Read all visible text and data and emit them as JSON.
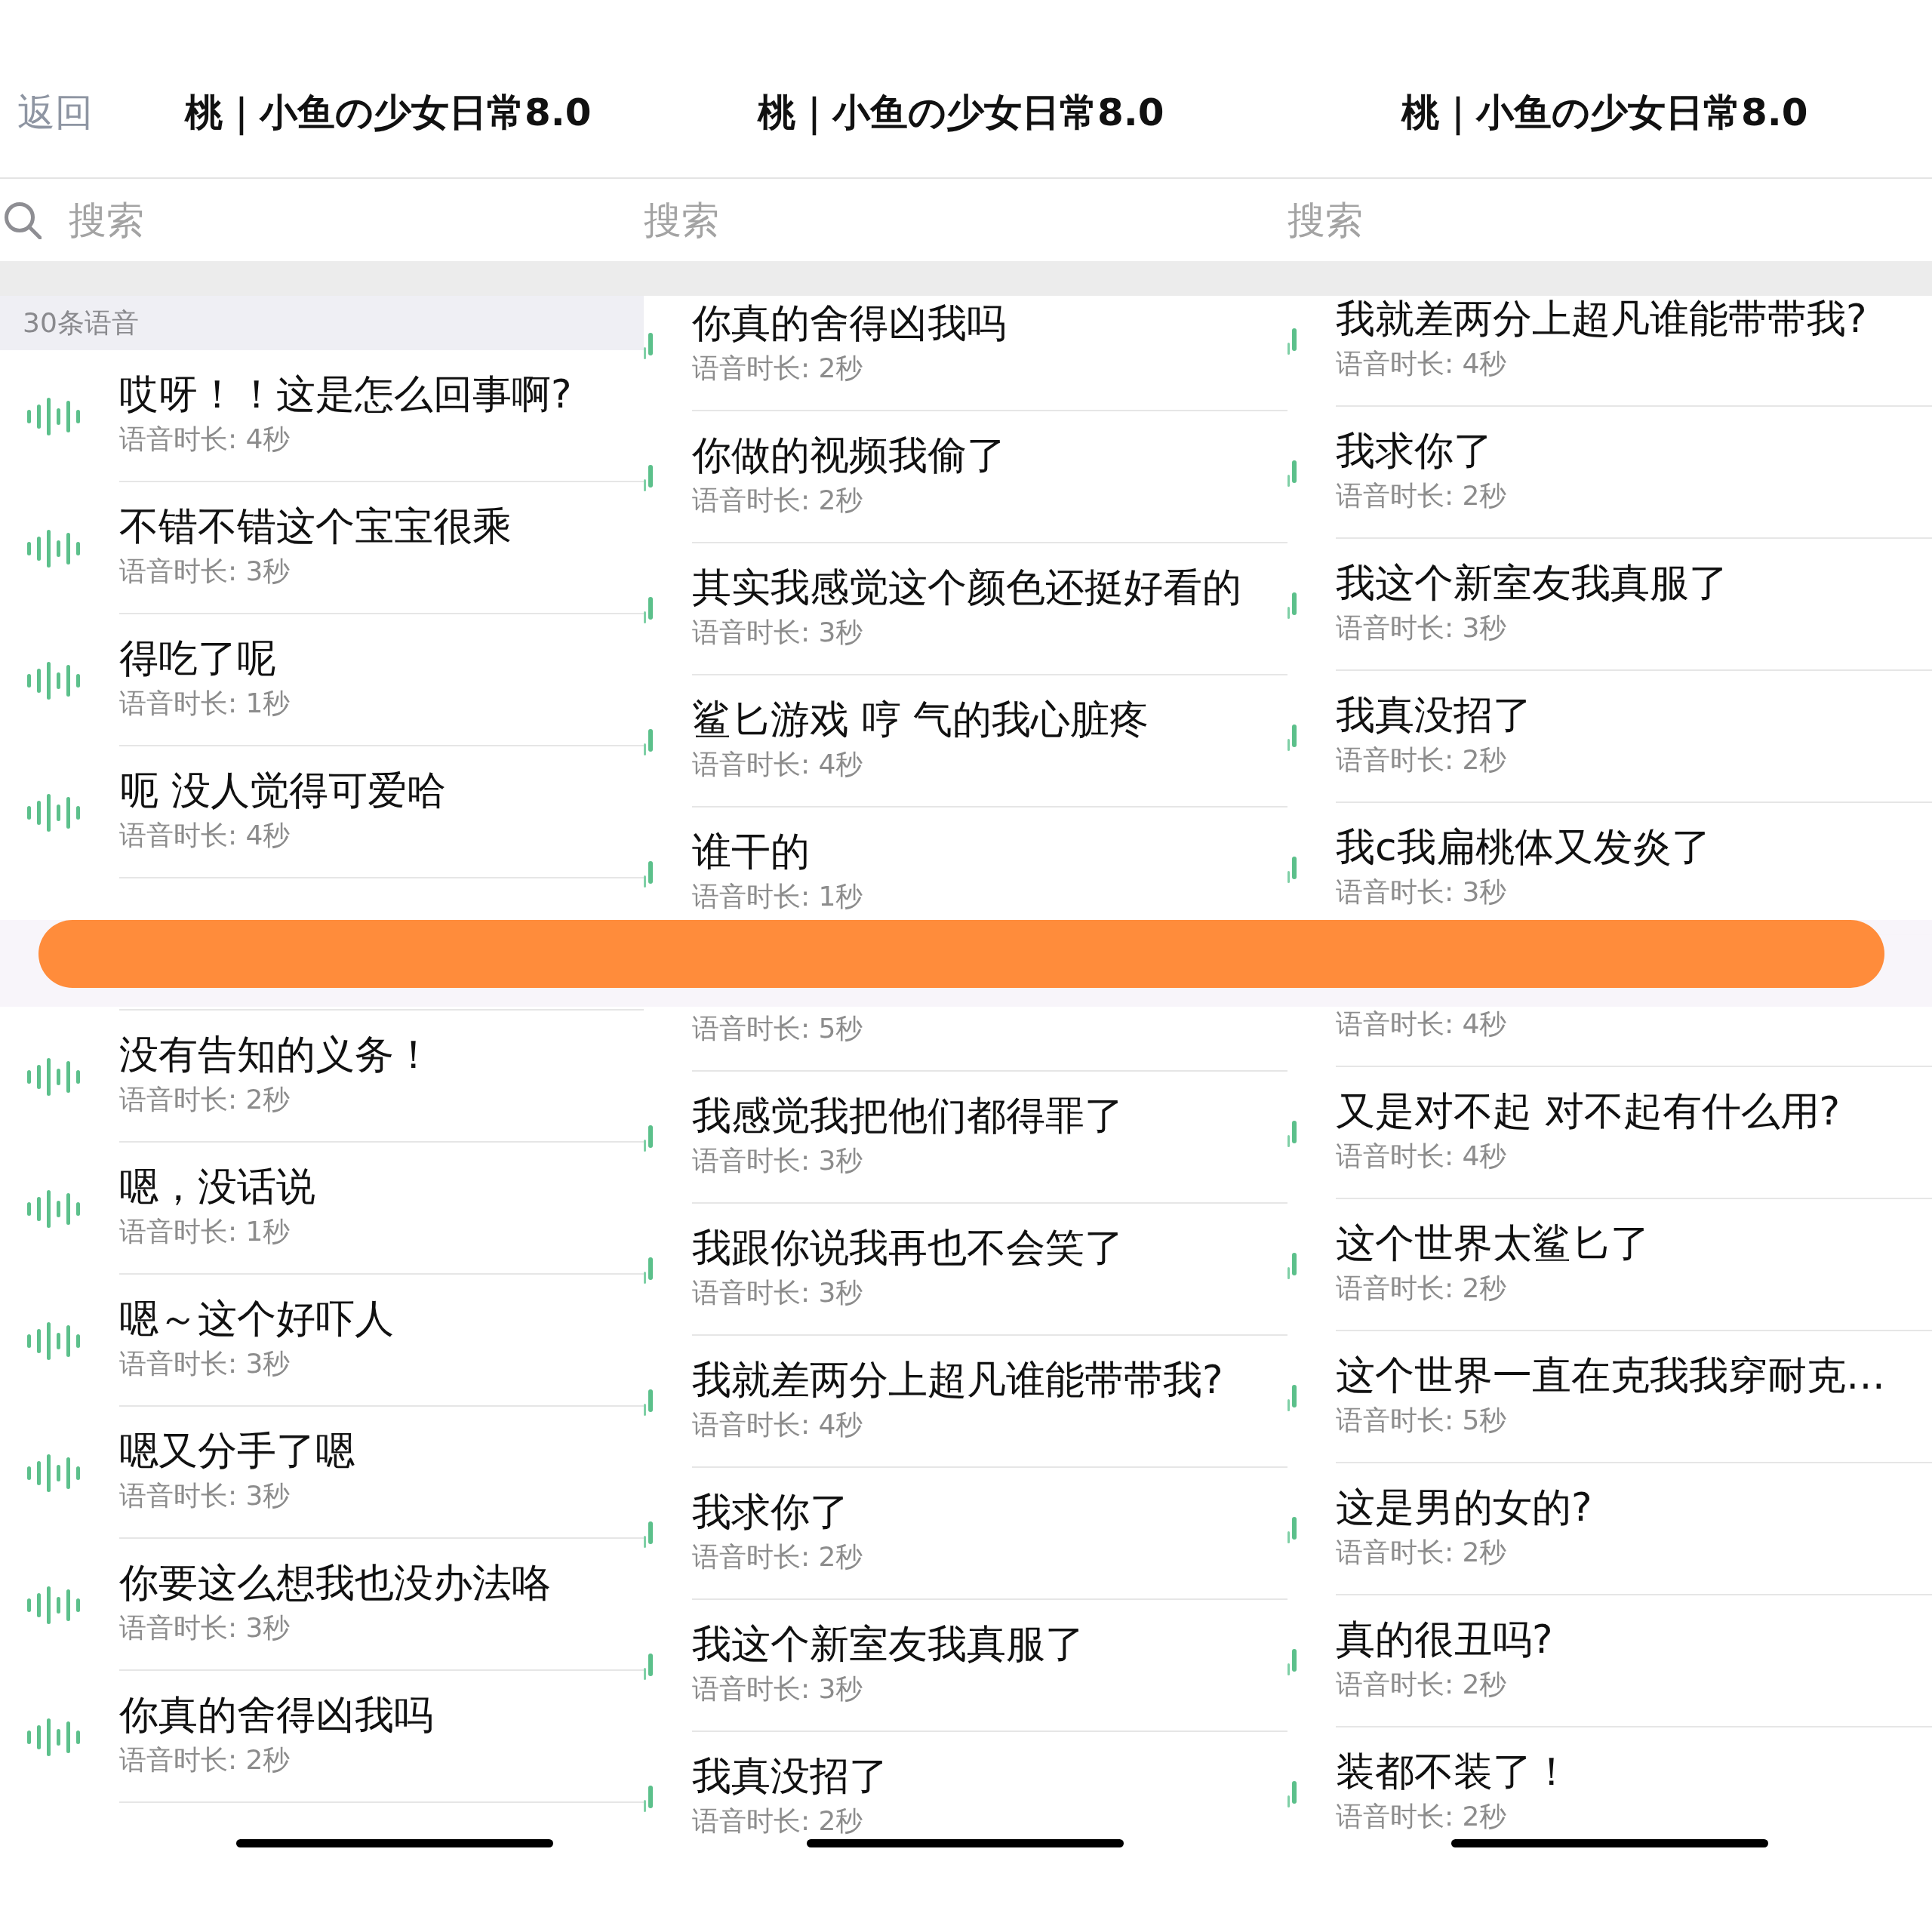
{
  "panels": [
    {
      "kind": "front",
      "back_label": "返回",
      "title": "桃｜小鱼の少女日常8.0",
      "search": {
        "placeholder": "搜索"
      },
      "section_header": "30条语音",
      "items": [
        {
          "kind": "voice",
          "title": "哎呀！！这是怎么回事啊?",
          "duration": "语音时长: 4秒"
        },
        {
          "kind": "voice",
          "title": "不错不错这个宝宝很乘",
          "duration": "语音时长: 3秒"
        },
        {
          "kind": "voice",
          "title": "得吃了呢",
          "duration": "语音时长: 1秒"
        },
        {
          "kind": "voice",
          "title": "呃 没人觉得可爱哈",
          "duration": "语音时长: 4秒"
        },
        {
          "kind": "covered"
        },
        {
          "kind": "voice",
          "title": "没有告知的义务！",
          "duration": "语音时长: 2秒"
        },
        {
          "kind": "voice",
          "title": "嗯，没话说",
          "duration": "语音时长: 1秒"
        },
        {
          "kind": "voice",
          "title": "嗯～这个好吓人",
          "duration": "语音时长: 3秒"
        },
        {
          "kind": "voice",
          "title": "嗯又分手了嗯",
          "duration": "语音时长: 3秒"
        },
        {
          "kind": "voice",
          "title": "你要这么想我也没办法咯",
          "duration": "语音时长: 3秒"
        },
        {
          "kind": "voice",
          "title": "你真的舍得凶我吗",
          "duration": "语音时长: 2秒"
        }
      ]
    },
    {
      "kind": "clipped",
      "title": "桃｜小鱼の少女日常8.0",
      "search": {
        "placeholder": "搜索"
      },
      "items": [
        {
          "kind": "voice",
          "title": "你真的舍得凶我吗",
          "duration": "语音时长: 2秒"
        },
        {
          "kind": "voice",
          "title": "你做的视频我偷了",
          "duration": "语音时长: 2秒"
        },
        {
          "kind": "voice",
          "title": "其实我感觉这个颜色还挺好看的",
          "duration": "语音时长: 3秒"
        },
        {
          "kind": "voice",
          "title": "鲨匕游戏 哼 气的我心脏疼",
          "duration": "语音时长: 4秒"
        },
        {
          "kind": "voice",
          "title": "谁干的",
          "duration": "语音时长: 1秒"
        },
        {
          "kind": "covered",
          "duration": "语音时长: 5秒"
        },
        {
          "kind": "voice",
          "title": "我感觉我把他们都得罪了",
          "duration": "语音时长: 3秒"
        },
        {
          "kind": "voice",
          "title": "我跟你说我再也不会笑了",
          "duration": "语音时长: 3秒"
        },
        {
          "kind": "voice",
          "title": "我就差两分上超凡谁能带带我?",
          "duration": "语音时长: 4秒"
        },
        {
          "kind": "voice",
          "title": "我求你了",
          "duration": "语音时长: 2秒"
        },
        {
          "kind": "voice",
          "title": "我这个新室友我真服了",
          "duration": "语音时长: 3秒"
        },
        {
          "kind": "voice",
          "title": "我真没招了",
          "duration": "语音时长: 2秒"
        }
      ]
    },
    {
      "kind": "clipped",
      "title": "桃｜小鱼の少女日常8.0",
      "search": {
        "placeholder": "搜索"
      },
      "items": [
        {
          "kind": "voice",
          "title": "我就差两分上超凡谁能带带我?",
          "duration": "语音时长: 4秒"
        },
        {
          "kind": "voice",
          "title": "我求你了",
          "duration": "语音时长: 2秒"
        },
        {
          "kind": "voice",
          "title": "我这个新室友我真服了",
          "duration": "语音时长: 3秒"
        },
        {
          "kind": "voice",
          "title": "我真没招了",
          "duration": "语音时长: 2秒"
        },
        {
          "kind": "voice",
          "title": "我c我扁桃体又发炎了",
          "duration": "语音时长: 3秒"
        },
        {
          "kind": "covered",
          "duration": "语音时长: 4秒"
        },
        {
          "kind": "voice",
          "title": "又是对不起 对不起有什么用?",
          "duration": "语音时长: 4秒"
        },
        {
          "kind": "voice",
          "title": "这个世界太鲨匕了",
          "duration": "语音时长: 2秒"
        },
        {
          "kind": "voice",
          "title": "这个世界一直在克我我穿耐克…",
          "duration": "语音时长: 5秒"
        },
        {
          "kind": "voice",
          "title": "这是男的女的?",
          "duration": "语音时长: 2秒"
        },
        {
          "kind": "voice",
          "title": "真的很丑吗?",
          "duration": "语音时长: 2秒"
        },
        {
          "kind": "voice",
          "title": "装都不装了！",
          "duration": "语音时长: 2秒"
        }
      ]
    }
  ]
}
